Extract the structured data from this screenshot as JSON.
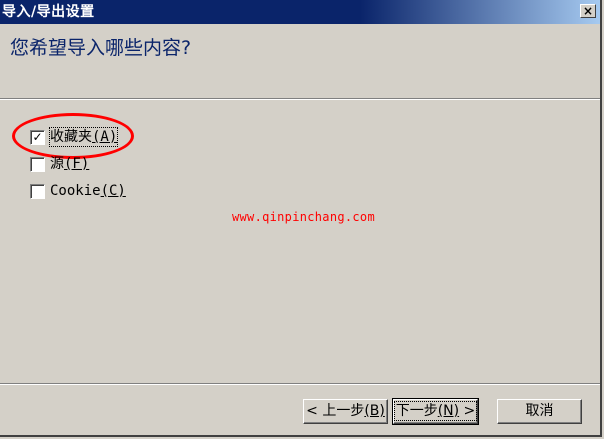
{
  "window": {
    "title": "导入/导出设置",
    "close_glyph": "×"
  },
  "header": {
    "question": "您希望导入哪些内容?"
  },
  "options": [
    {
      "label": "收藏夹",
      "hotkey": "(A)",
      "checked": true
    },
    {
      "label": "源",
      "hotkey": "(F)",
      "checked": false
    },
    {
      "label": "Cookie",
      "hotkey": "(C)",
      "checked": false
    }
  ],
  "checkmark_glyph": "✓",
  "watermark": "www.qinpinchang.com",
  "buttons": {
    "back": {
      "prefix": "< ",
      "label": "上一步",
      "hotkey": "(B)"
    },
    "next": {
      "label": "下一步",
      "hotkey": "(N)",
      "suffix": " >"
    },
    "cancel": {
      "label": "取消"
    }
  },
  "colors": {
    "titlebar": "#0a246a",
    "face": "#d4d0c8",
    "heading": "#0a246a",
    "annotation": "#ff0000"
  }
}
